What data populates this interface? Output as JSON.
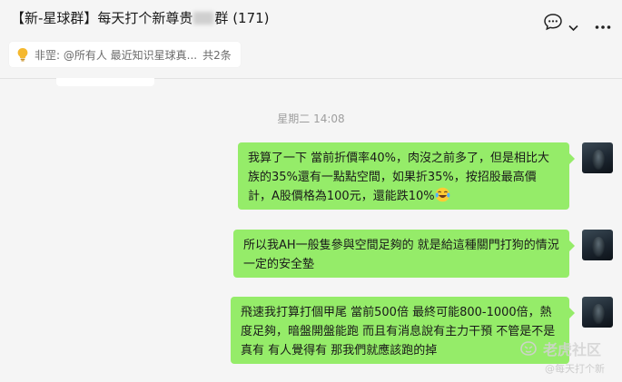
{
  "header": {
    "title_prefix": "【新-星球群】每天打个新尊贵",
    "title_suffix": "群 (171)",
    "icons": [
      "chat-bubble-icon",
      "chevron-down-icon",
      "more-icon"
    ]
  },
  "pinned": {
    "text": "非罡: @所有人 最近知识星球真...",
    "count": "共2条",
    "icon": "lightbulb-icon"
  },
  "timestamp": "星期二 14:08",
  "messages": [
    {
      "text": "我算了一下 當前折價率40%，肉沒之前多了，但是相比大族的35%還有一點點空間，如果折35%，按招股最高價計，A股價格為100元，還能跌10%",
      "emoji": "laughing-tears-emoji"
    },
    {
      "text": "所以我AH一般隻參與空間足夠的 就是給這種關門打狗的情況一定的安全墊"
    },
    {
      "text": "飛速我打算打個甲尾 當前500倍 最終可能800-1000倍，熱度足夠，暗盤開盤能跑 而且有消息說有主力干預 不管是不是真有 有人覺得有 那我們就應該跑的掉"
    }
  ],
  "watermarks": {
    "brand": "老虎社区",
    "handle": "@每天打个新"
  },
  "colors": {
    "self_bubble": "#95ec69",
    "background": "#f5f5f5"
  }
}
